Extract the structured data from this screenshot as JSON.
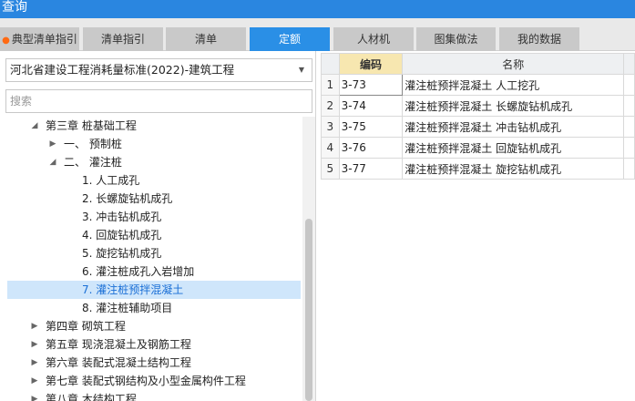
{
  "window": {
    "title": "查询"
  },
  "tabs": [
    {
      "label": "典型清单指引",
      "fire": true,
      "active": false
    },
    {
      "label": "清单指引",
      "active": false
    },
    {
      "label": "清单",
      "active": false
    },
    {
      "label": "定额",
      "active": true
    },
    {
      "label": "人材机",
      "active": false
    },
    {
      "label": "图集做法",
      "active": false
    },
    {
      "label": "我的数据",
      "active": false
    }
  ],
  "left_panel": {
    "dropdown_value": "河北省建设工程消耗量标准(2022)-建筑工程",
    "search_placeholder": "搜索",
    "tree": [
      {
        "label": "第三章 桩基础工程",
        "toggle": "◢"
      },
      {
        "label": "一、 预制桩",
        "toggle": "▶"
      },
      {
        "label": "二、 灌注桩",
        "toggle": "◢"
      },
      {
        "label": "1. 人工成孔",
        "toggle": ""
      },
      {
        "label": "2. 长螺旋钻机成孔",
        "toggle": ""
      },
      {
        "label": "3. 冲击钻机成孔",
        "toggle": ""
      },
      {
        "label": "4. 回旋钻机成孔",
        "toggle": ""
      },
      {
        "label": "5. 旋挖钻机成孔",
        "toggle": ""
      },
      {
        "label": "6. 灌注桩成孔入岩增加",
        "toggle": ""
      },
      {
        "label": "7. 灌注桩预拌混凝土",
        "toggle": "",
        "selected": true
      },
      {
        "label": "8. 灌注桩辅助项目",
        "toggle": ""
      },
      {
        "label": "第四章 砌筑工程",
        "toggle": "▶"
      },
      {
        "label": "第五章 现浇混凝土及钢筋工程",
        "toggle": "▶"
      },
      {
        "label": "第六章 装配式混凝土结构工程",
        "toggle": "▶"
      },
      {
        "label": "第七章 装配式钢结构及小型金属构件工程",
        "toggle": "▶"
      },
      {
        "label": "第八章 木结构工程",
        "toggle": "▶"
      }
    ]
  },
  "grid": {
    "headers": {
      "row_no": "",
      "code": "编码",
      "name": "名称"
    },
    "rows": [
      {
        "no": "1",
        "code": "3-73",
        "name": "灌注桩预拌混凝土 人工挖孔"
      },
      {
        "no": "2",
        "code": "3-74",
        "name": "灌注桩预拌混凝土 长螺旋钻机成孔"
      },
      {
        "no": "3",
        "code": "3-75",
        "name": "灌注桩预拌混凝土 冲击钻机成孔"
      },
      {
        "no": "4",
        "code": "3-76",
        "name": "灌注桩预拌混凝土 回旋钻机成孔"
      },
      {
        "no": "5",
        "code": "3-77",
        "name": "灌注桩预拌混凝土 旋挖钻机成孔"
      }
    ]
  },
  "colors": {
    "titlebar": "#2a86e0",
    "active_tab": "#2a8fe6",
    "selected_row": "#cfe6fb",
    "code_header": "#f7e7b0"
  },
  "icons": {
    "fire": "fire-icon",
    "dropdown": "chevron-down-icon",
    "expanded": "triangle-down-icon",
    "collapsed": "triangle-right-icon"
  }
}
